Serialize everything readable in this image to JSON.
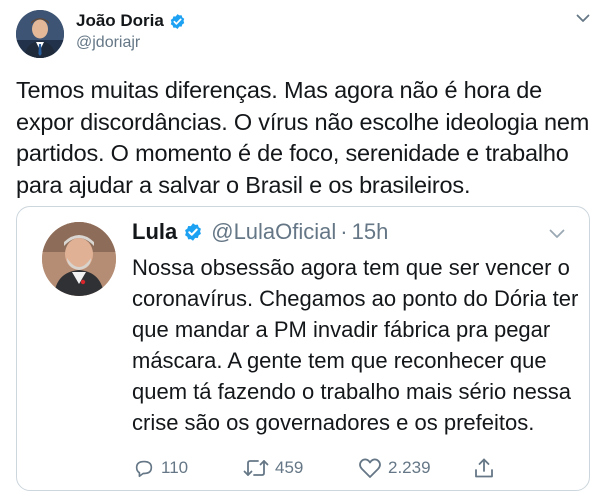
{
  "tweet": {
    "author_name": "João Doria",
    "author_handle": "@jdoriajr",
    "verified": true,
    "text": "Temos muitas diferenças. Mas agora não é hora de expor discordâncias. O vírus não escolhe ideologia nem partidos. O momento é de foco, serenidade e trabalho para ajudar a salvar o Brasil e os brasileiros."
  },
  "quoted_tweet": {
    "author_name": "Lula",
    "author_handle": "@LulaOficial",
    "separator": "·",
    "time": "15h",
    "verified": true,
    "text": "Nossa obsessão agora tem que ser vencer o coronavírus. Chegamos ao ponto do Dória ter que mandar a PM invadir fábrica pra pegar máscara. A gente tem que reconhecer que quem tá fazendo o trabalho mais sério nessa crise são os governadores e os prefeitos.",
    "actions": {
      "replies": "110",
      "retweets": "459",
      "likes": "2.239"
    }
  },
  "colors": {
    "verified_blue": "#1da1f2",
    "secondary_text": "#657786",
    "border": "#ccd6dd"
  },
  "icons": [
    "verified-badge-icon",
    "chevron-down-icon",
    "reply-icon",
    "retweet-icon",
    "like-icon",
    "share-icon"
  ]
}
